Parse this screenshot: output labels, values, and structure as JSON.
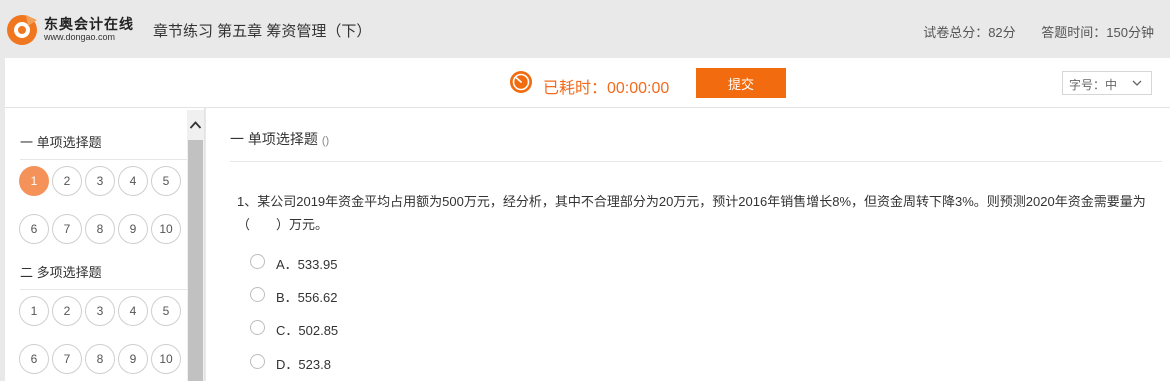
{
  "header": {
    "logo_text": "东奥会计在线",
    "logo_url": "www.dongao.com",
    "exam_title": "章节练习 第五章 筹资管理（下）",
    "total_score": "试卷总分：82分",
    "answer_time": "答题时间：150分钟"
  },
  "toolbar": {
    "timer_label": "已耗时：00:00:00",
    "submit_label": "提交",
    "font_size_label": "字号：中"
  },
  "sidebar": {
    "sections": [
      {
        "title": "一 单项选择题",
        "numbers": [
          "1",
          "2",
          "3",
          "4",
          "5",
          "6",
          "7",
          "8",
          "9",
          "10"
        ],
        "active_index": 0
      },
      {
        "title": "二 多项选择题",
        "numbers": [
          "1",
          "2",
          "3",
          "4",
          "5",
          "6",
          "7",
          "8",
          "9",
          "10"
        ],
        "active_index": null
      }
    ]
  },
  "main": {
    "section_title": "一 单项选择题",
    "section_count": "()",
    "question_text": "1、某公司2019年资金平均占用额为500万元，经分析，其中不合理部分为20万元，预计2016年销售增长8%，但资金周转下降3%。则预测2020年资金需要量为（　　）万元。",
    "options": [
      "A．533.95",
      "B．556.62",
      "C．502.85",
      "D．523.8"
    ]
  },
  "colors": {
    "accent": "#f26b0e",
    "active_number": "#f5925a",
    "timer_text": "#f26b1d"
  },
  "icons": {
    "logo": "dongao-logo-icon",
    "timer": "timer-icon",
    "dropdown": "chevron-down-icon",
    "scroll_up": "chevron-up-icon"
  }
}
